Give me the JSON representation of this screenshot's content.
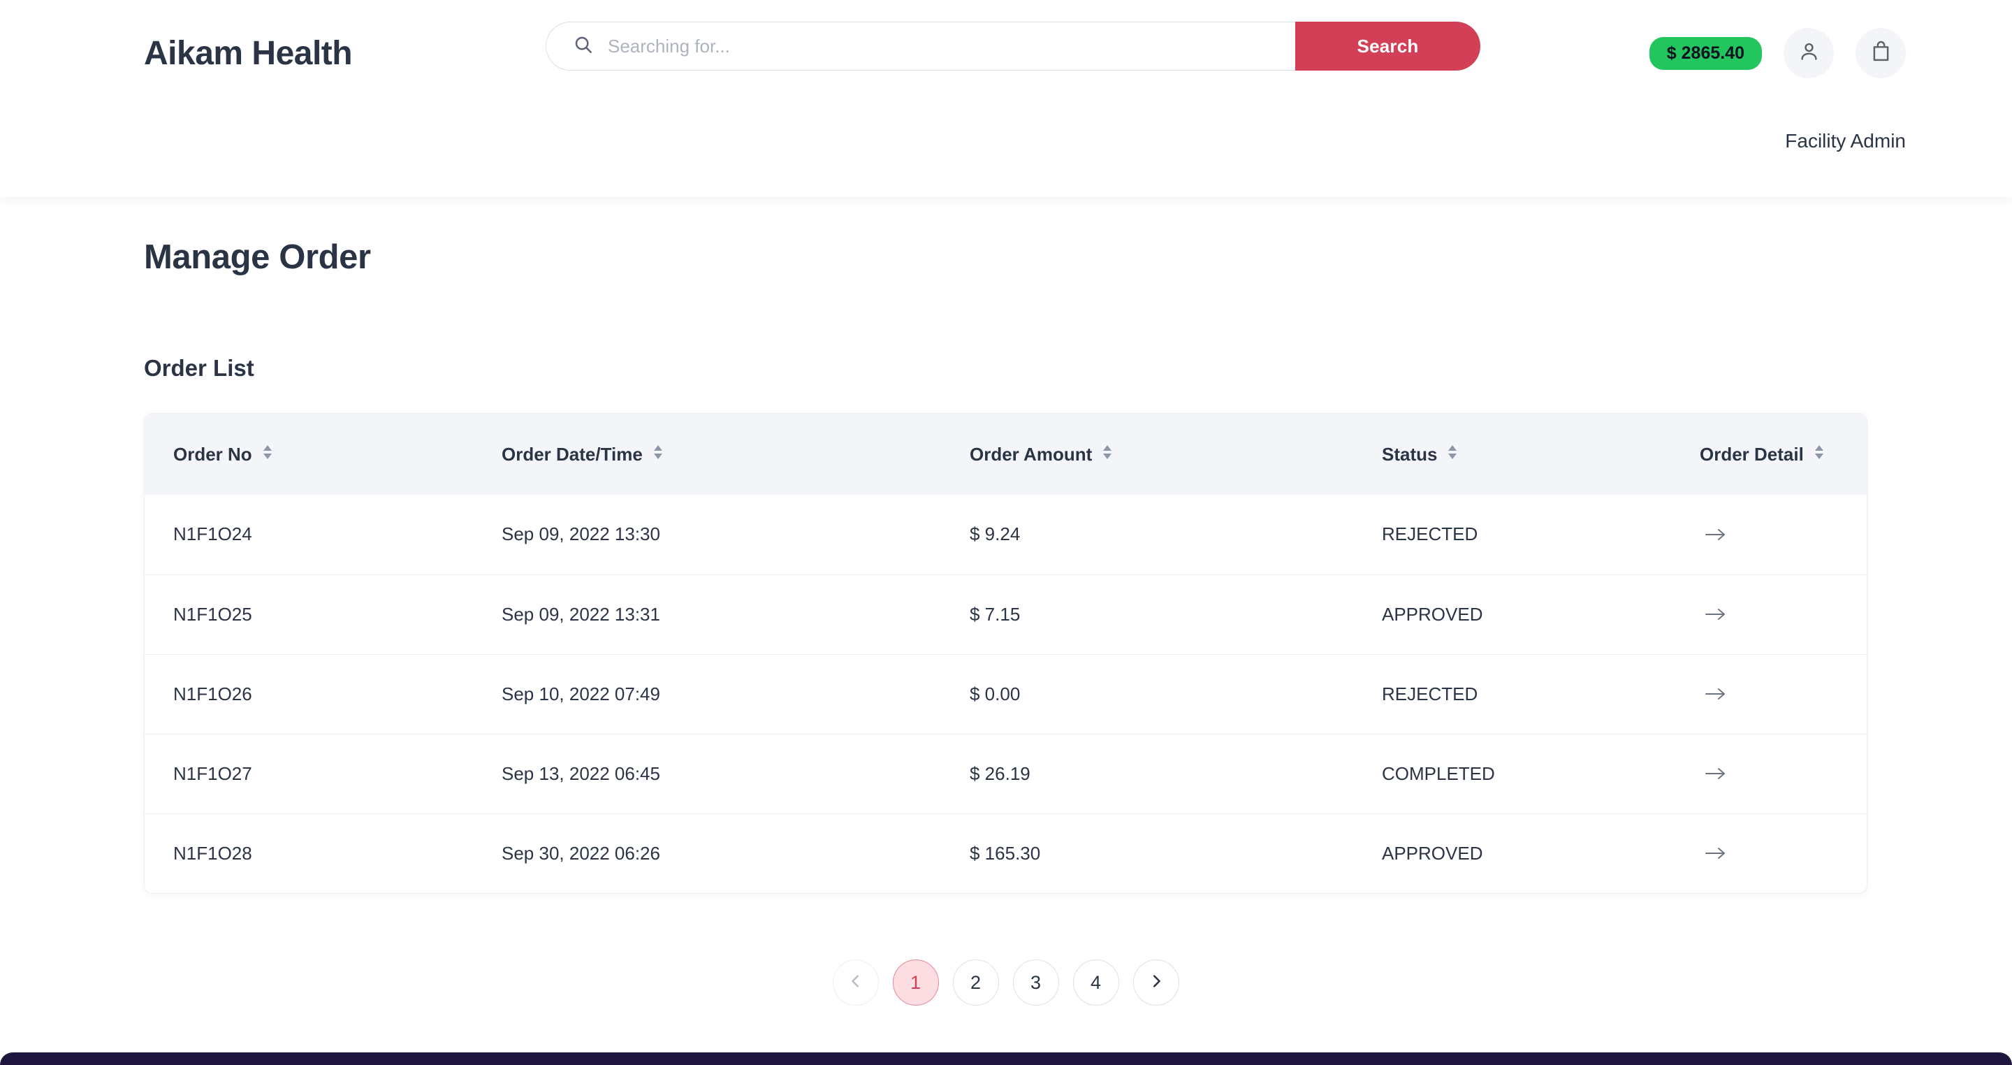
{
  "header": {
    "brand": "Aikam Health",
    "search": {
      "placeholder": "Searching for...",
      "value": "",
      "button_label": "Search",
      "icon": "search-icon"
    },
    "balance": "$ 2865.40",
    "account_icon": "person-icon",
    "cart_icon": "shopping-bag-icon",
    "role": "Facility Admin"
  },
  "main": {
    "page_title": "Manage Order",
    "section_title": "Order List"
  },
  "table": {
    "columns": [
      {
        "label": "Order No",
        "sort_icon": "sort-icon"
      },
      {
        "label": "Order Date/Time",
        "sort_icon": "sort-icon"
      },
      {
        "label": "Order Amount",
        "sort_icon": "sort-icon"
      },
      {
        "label": "Status",
        "sort_icon": "sort-icon"
      },
      {
        "label": "Order Detail",
        "sort_icon": "sort-icon"
      }
    ],
    "rows": [
      {
        "order_no": "N1F1O24",
        "order_datetime": "Sep 09, 2022 13:30",
        "order_amount": "$ 9.24",
        "status": "REJECTED",
        "detail_icon": "arrow-right-icon"
      },
      {
        "order_no": "N1F1O25",
        "order_datetime": "Sep 09, 2022 13:31",
        "order_amount": "$ 7.15",
        "status": "APPROVED",
        "detail_icon": "arrow-right-icon"
      },
      {
        "order_no": "N1F1O26",
        "order_datetime": "Sep 10, 2022 07:49",
        "order_amount": "$ 0.00",
        "status": "REJECTED",
        "detail_icon": "arrow-right-icon"
      },
      {
        "order_no": "N1F1O27",
        "order_datetime": "Sep 13, 2022 06:45",
        "order_amount": "$ 26.19",
        "status": "COMPLETED",
        "detail_icon": "arrow-right-icon"
      },
      {
        "order_no": "N1F1O28",
        "order_datetime": "Sep 30, 2022 06:26",
        "order_amount": "$ 165.30",
        "status": "APPROVED",
        "detail_icon": "arrow-right-icon"
      }
    ]
  },
  "pagination": {
    "prev_icon": "chevron-left-icon",
    "next_icon": "chevron-right-icon",
    "pages": [
      "1",
      "2",
      "3",
      "4"
    ],
    "active_page": "1"
  },
  "colors": {
    "brand_red": "#d23f57",
    "balance_green": "#22c55e",
    "text_dark": "#2b3445",
    "table_header_bg": "#f3f5f9",
    "active_page_bg": "#fbdde2",
    "footer": "#1f1640"
  }
}
